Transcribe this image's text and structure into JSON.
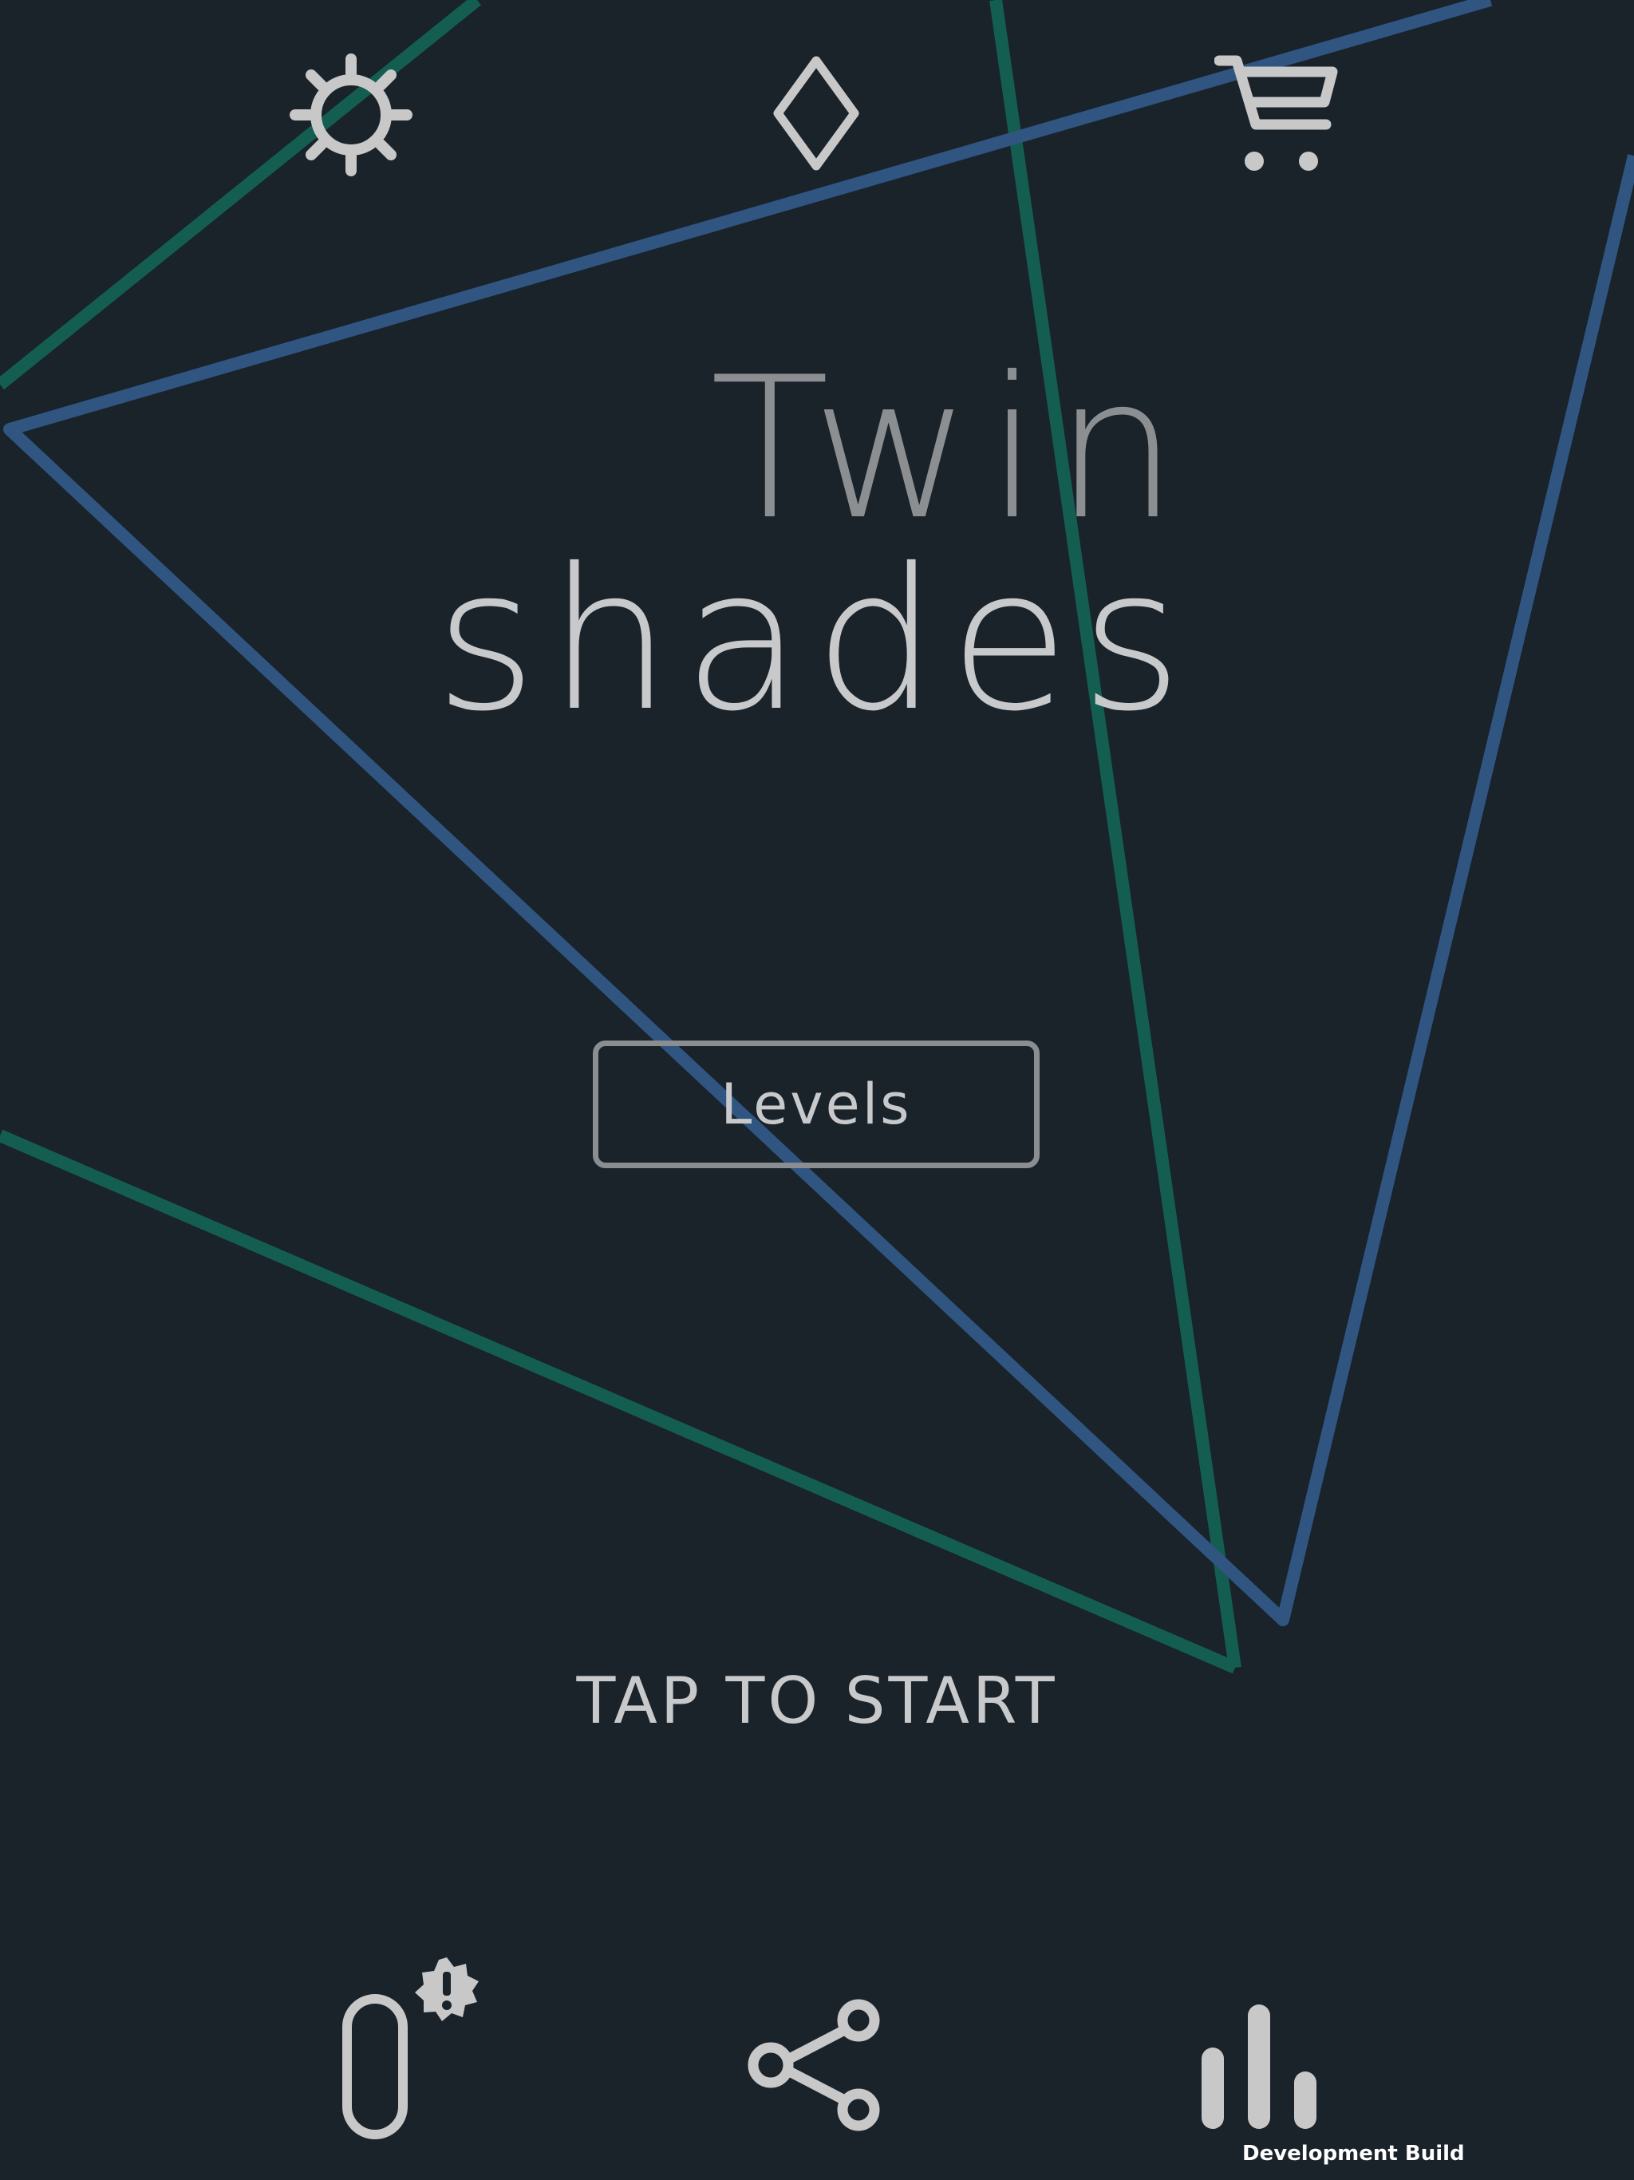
{
  "game": {
    "title_line1": "Twin",
    "title_line2": "shades",
    "levels_label": "Levels",
    "tap_to_start": "TAP TO START",
    "dev_build_label": "Development Build"
  },
  "top_bar": {
    "icons": [
      "gear-icon",
      "diamond-icon",
      "cart-icon"
    ]
  },
  "bottom_bar": {
    "icons": [
      "capsule-icon",
      "alert-badge-icon",
      "share-icon",
      "stats-icon"
    ]
  },
  "colors": {
    "background": "#1a222a",
    "blue_line": "#2f5580",
    "green_line": "#135e50",
    "icon": "#c8c8c8",
    "title_dim": "#8c8f92",
    "title_bright": "#c8c9cb"
  }
}
